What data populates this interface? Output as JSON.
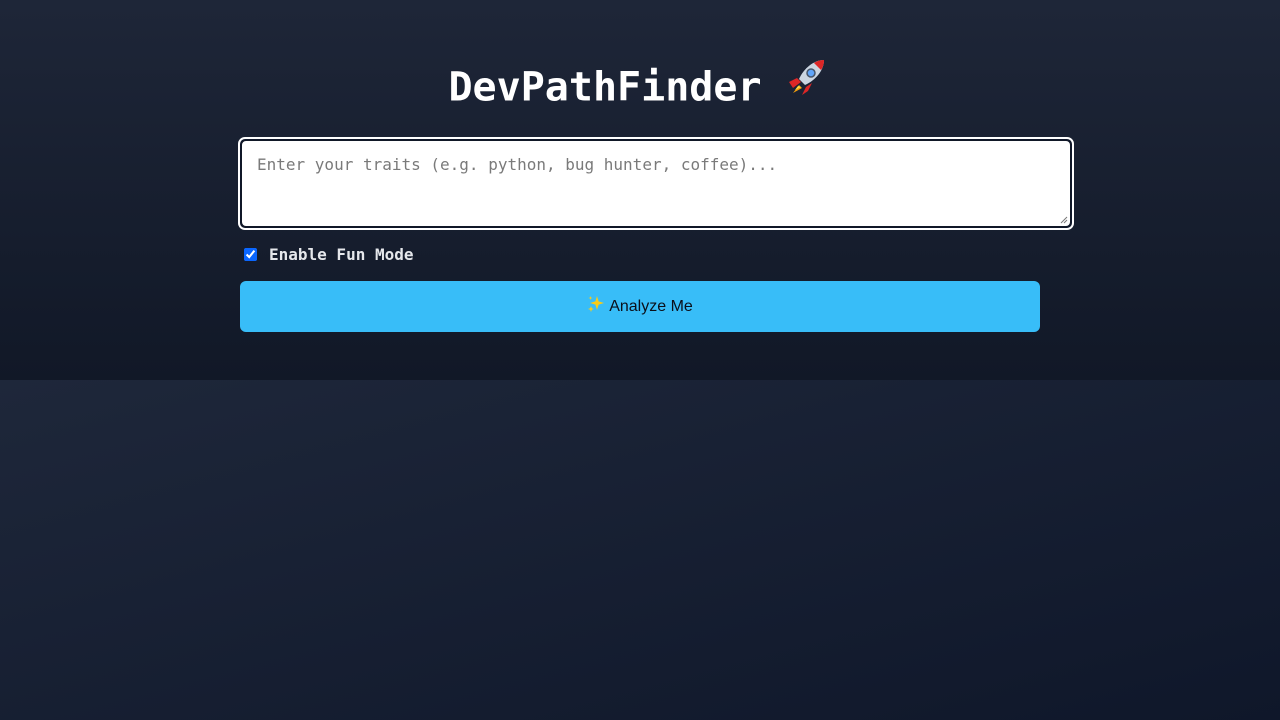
{
  "app": {
    "title": "DevPathFinder",
    "title_icon": "rocket-icon"
  },
  "traits": {
    "placeholder": "Enter your traits (e.g. python, bug hunter, coffee)...",
    "value": ""
  },
  "fun_mode": {
    "label": "Enable Fun Mode",
    "checked": true
  },
  "analyze": {
    "label": "Analyze Me",
    "icon": "sparkles-icon"
  },
  "colors": {
    "accent": "#38bdf8",
    "background": "#0f172a",
    "checkbox": "#0a66ff"
  }
}
